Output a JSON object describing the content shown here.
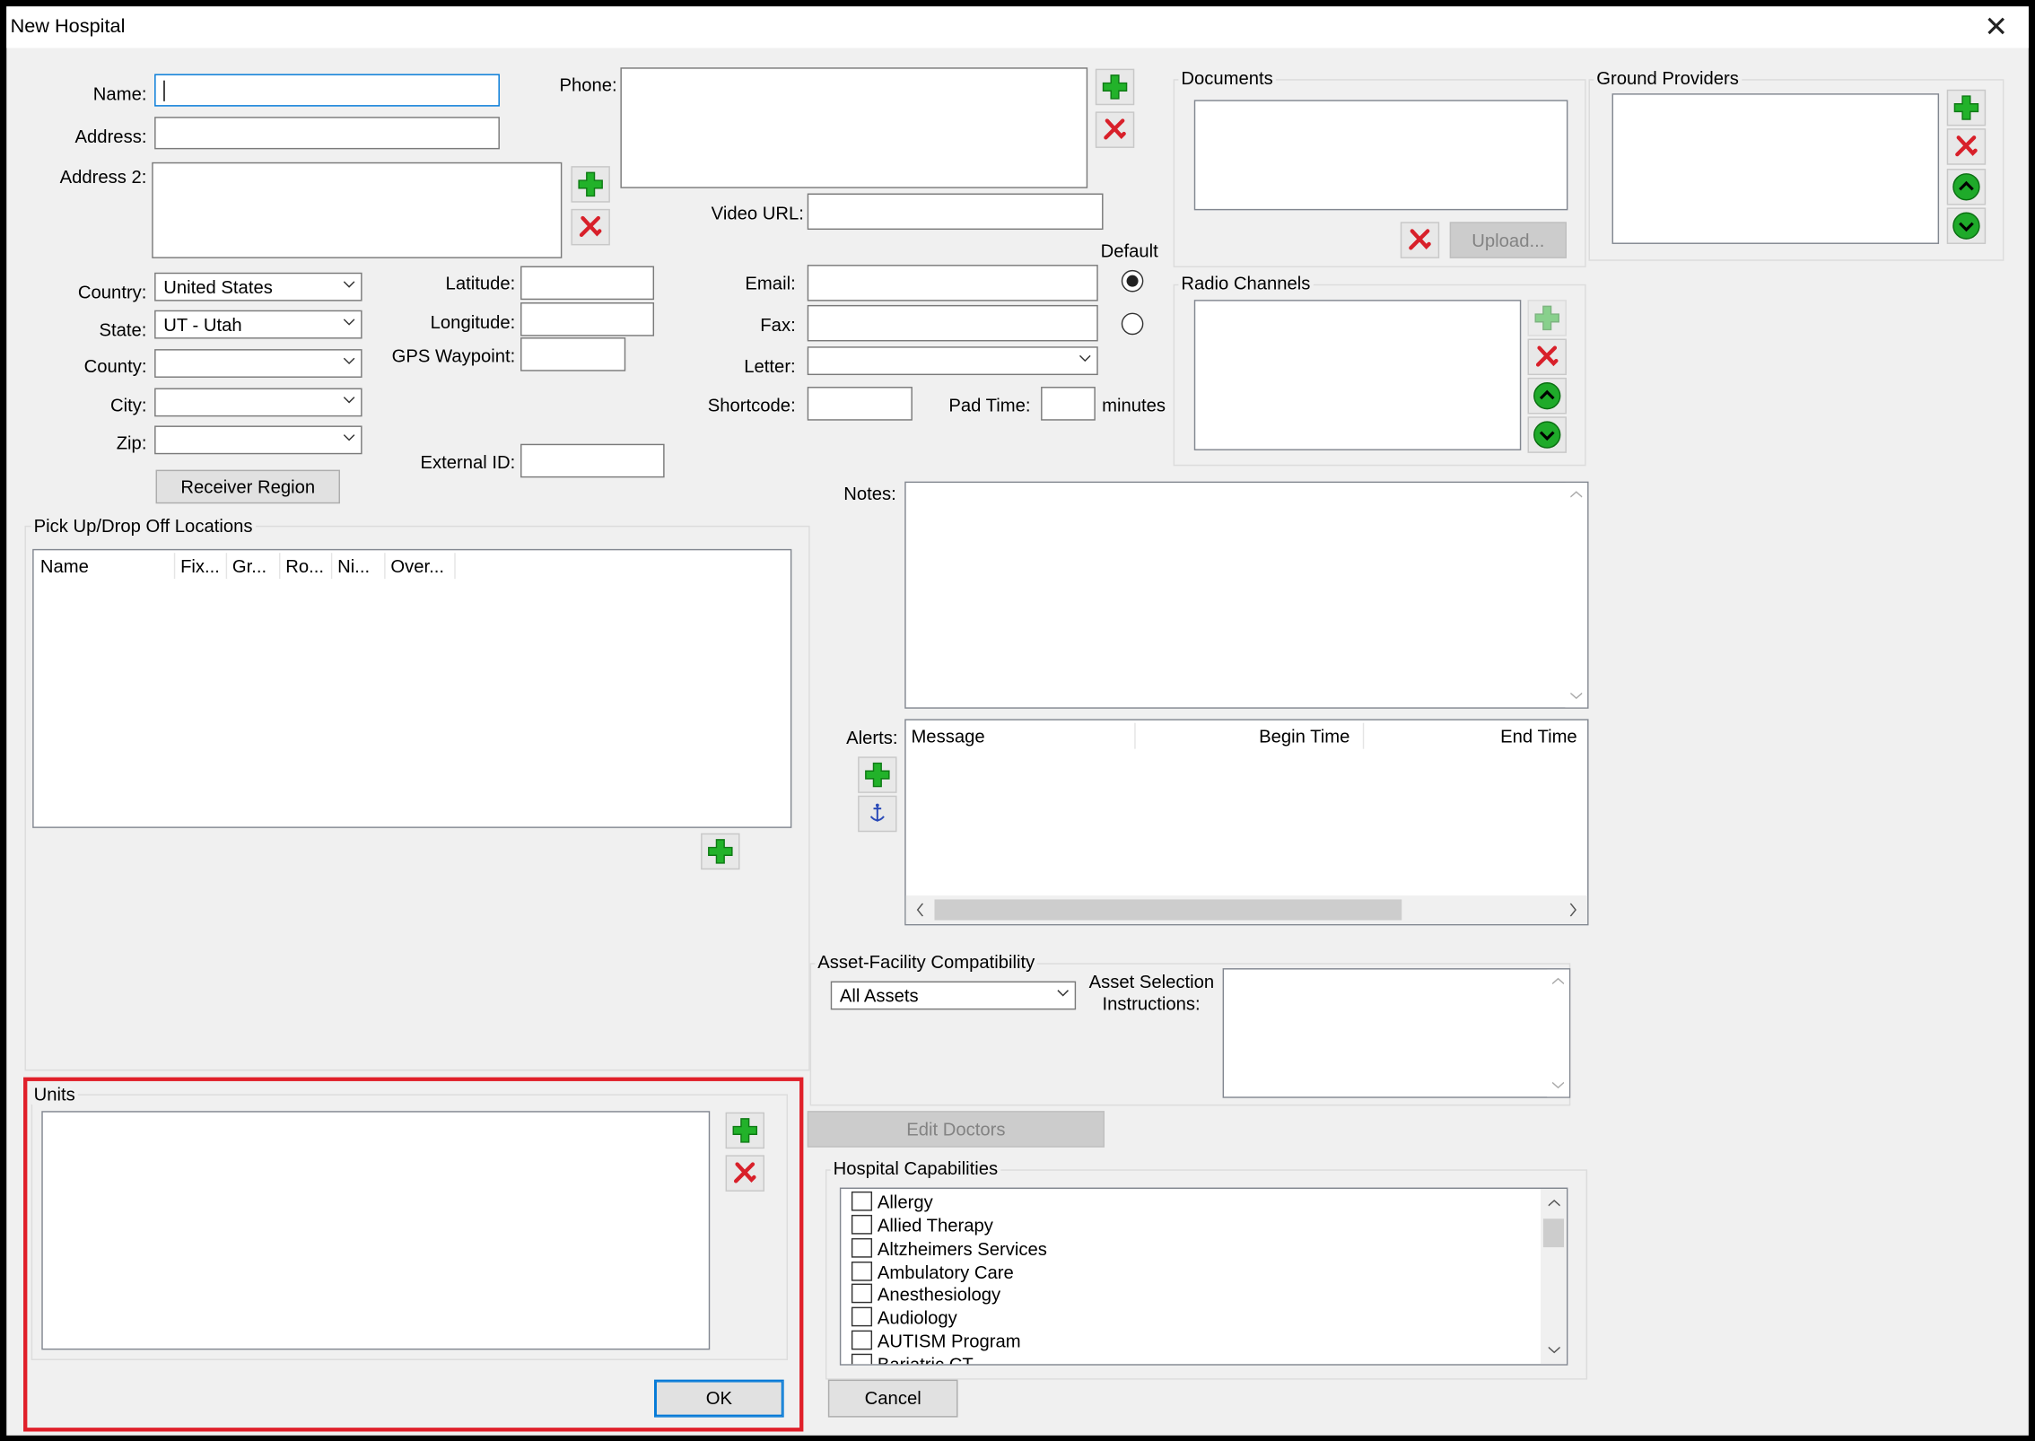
{
  "window": {
    "title": "New Hospital"
  },
  "labels": {
    "name": "Name:",
    "address": "Address:",
    "address2": "Address 2:",
    "phone": "Phone:",
    "video_url": "Video URL:",
    "country": "Country:",
    "state": "State:",
    "county": "County:",
    "city": "City:",
    "zip": "Zip:",
    "latitude": "Latitude:",
    "longitude": "Longitude:",
    "gps_waypoint": "GPS Waypoint:",
    "external_id": "External ID:",
    "email": "Email:",
    "fax": "Fax:",
    "letter": "Letter:",
    "shortcode": "Shortcode:",
    "pad_time": "Pad Time:",
    "minutes": "minutes",
    "default": "Default",
    "notes": "Notes:",
    "alerts": "Alerts:",
    "asset_selection": "Asset Selection",
    "asset_instructions": "Instructions:"
  },
  "fields": {
    "country": "United States",
    "state": "UT - Utah",
    "county": "",
    "city": "",
    "zip": "",
    "letter": "",
    "asset_facility": "All Assets"
  },
  "buttons": {
    "receiver_region": "Receiver Region",
    "upload": "Upload...",
    "edit_doctors": "Edit Doctors",
    "ok": "OK",
    "cancel": "Cancel"
  },
  "groups": {
    "documents": "Documents",
    "ground_providers": "Ground Providers",
    "radio_channels": "Radio Channels",
    "pickup": "Pick Up/Drop Off Locations",
    "asset_facility": "Asset-Facility Compatibility",
    "units": "Units",
    "hospital_capabilities": "Hospital Capabilities"
  },
  "pickup_columns": [
    "Name",
    "Fix...",
    "Gr...",
    "Ro...",
    "Ni...",
    "Over..."
  ],
  "alerts_columns": [
    "Message",
    "Begin Time",
    "End Time"
  ],
  "capabilities": [
    {
      "label": "Allergy",
      "checked": false
    },
    {
      "label": "Allied Therapy",
      "checked": false
    },
    {
      "label": "Altzheimers Services",
      "checked": false
    },
    {
      "label": "Ambulatory Care",
      "checked": false
    },
    {
      "label": "Anesthesiology",
      "checked": false
    },
    {
      "label": "Audiology",
      "checked": false
    },
    {
      "label": "AUTISM Program",
      "checked": false
    },
    {
      "label": "Bariatric CT",
      "checked": false
    }
  ],
  "icons": {
    "add": "green-plus-icon",
    "remove": "red-x-icon",
    "up": "green-up-arrow-icon",
    "down": "green-down-arrow-icon",
    "alert_edit": "anchor-icon"
  },
  "colors": {
    "highlight": "#e0202a",
    "focus": "#0078d7",
    "add_green": "#22b22a",
    "remove_red": "#d8202a"
  }
}
